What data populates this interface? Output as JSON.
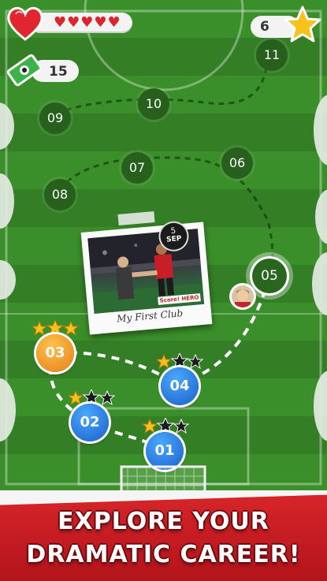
{
  "hud": {
    "hearts_icon": "heart-icon",
    "hearts_count": 5,
    "hearts_display": "♥♥♥♥♥",
    "cash_icon": "cash-icon",
    "cash": "15",
    "stars_icon": "star-icon",
    "stars": "6"
  },
  "map": {
    "upcoming": [
      "11",
      "10",
      "09",
      "07",
      "06",
      "08"
    ],
    "current": "05",
    "completed": [
      {
        "label": "03",
        "stars": 3
      },
      {
        "label": "04",
        "stars": 1
      },
      {
        "label": "02",
        "stars": 1
      },
      {
        "label": "01",
        "stars": 1
      }
    ]
  },
  "polaroid": {
    "date_day": "5",
    "date_month": "SEP",
    "caption": "My First Club",
    "logo": "Score! HERO"
  },
  "banner": {
    "line1": "EXPLORE YOUR",
    "line2": "DRAMATIC CAREER!"
  },
  "colors": {
    "pitch_light": "#3b8f2a",
    "pitch_dark": "#347f25",
    "banner_red": "#d8262a",
    "level_blue": "#1a5fc8",
    "level_orange": "#e5801a",
    "star_gold": "#f7c21a"
  }
}
